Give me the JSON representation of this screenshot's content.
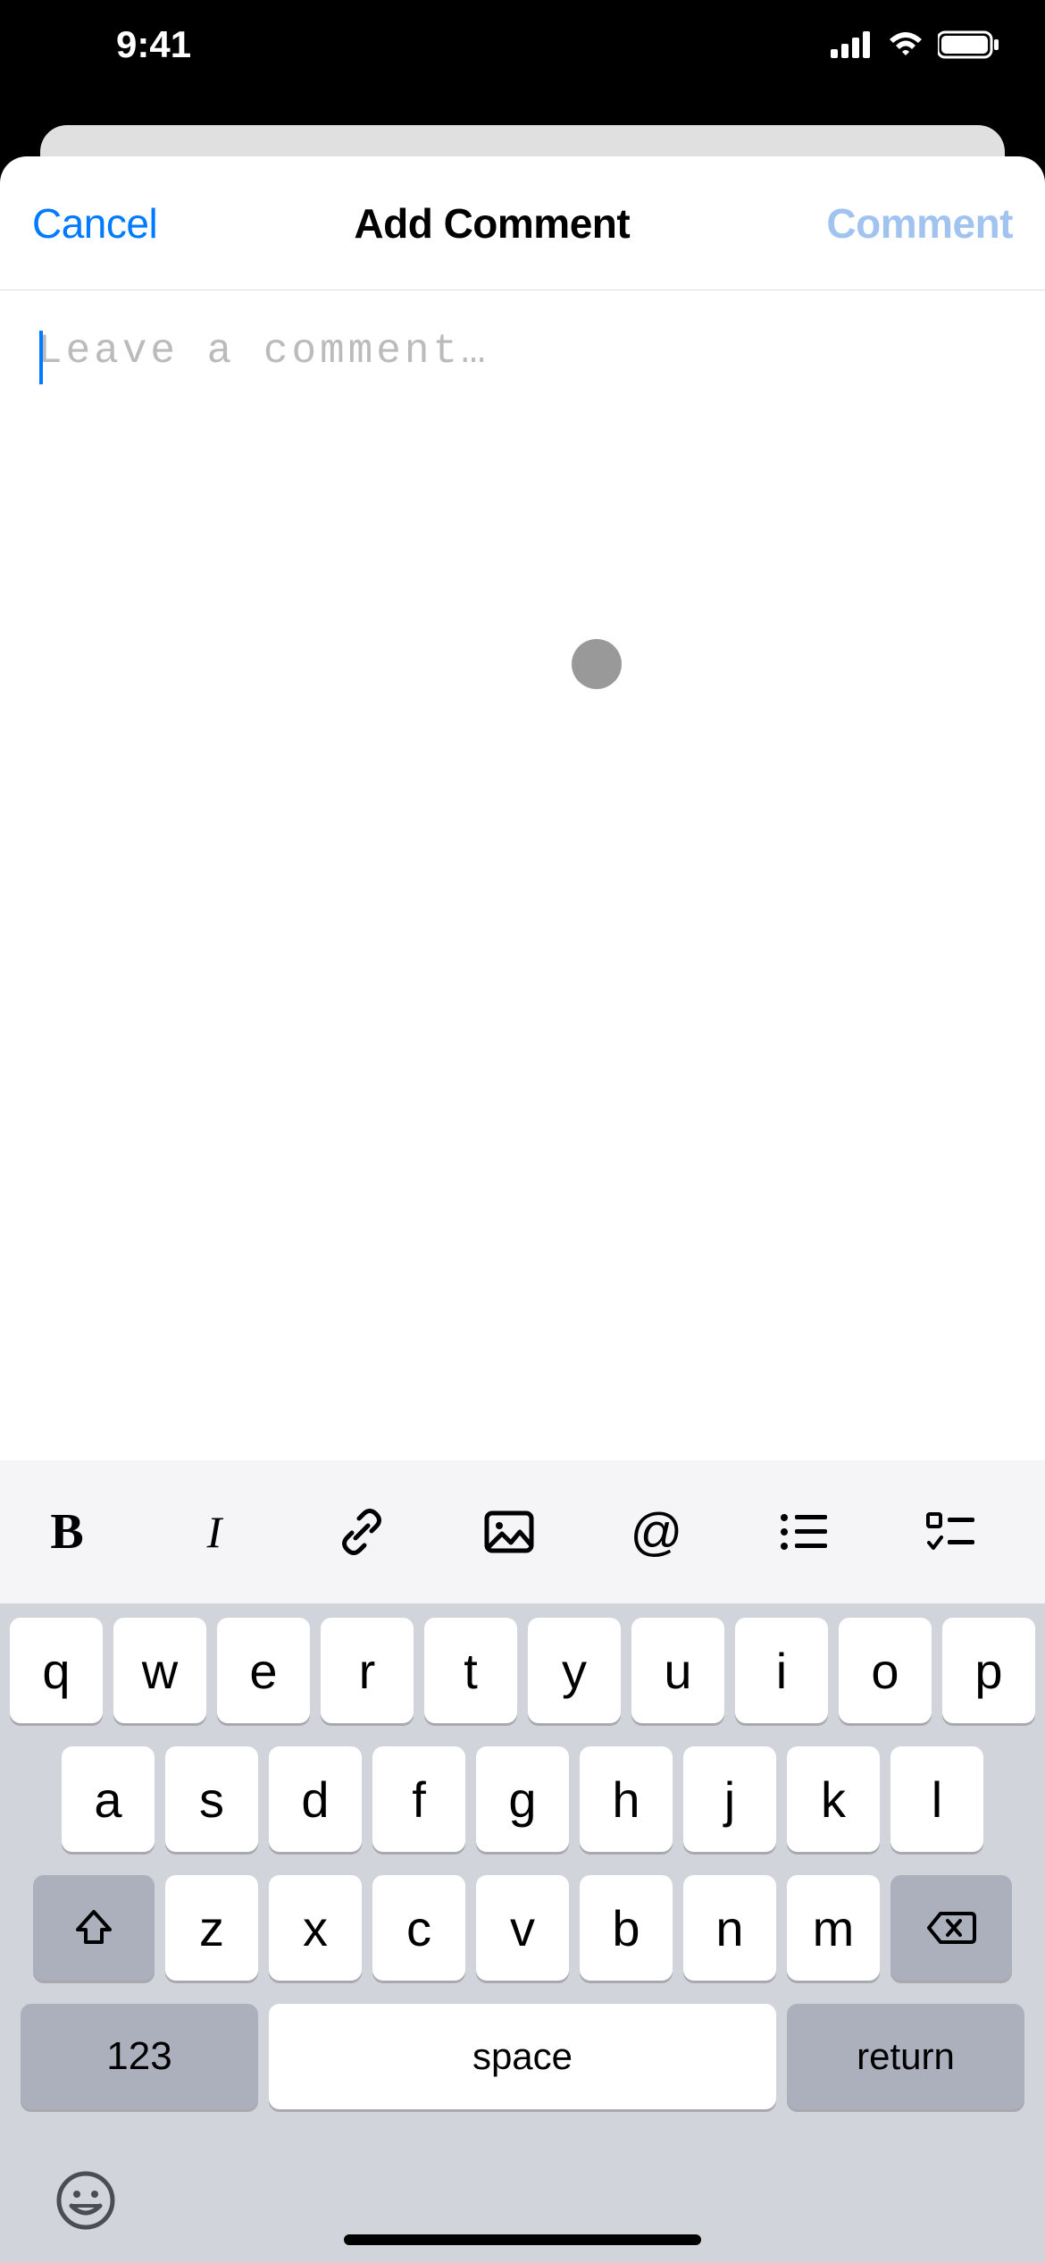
{
  "status": {
    "time": "9:41"
  },
  "modal": {
    "cancel": "Cancel",
    "title": "Add Comment",
    "submit": "Comment"
  },
  "editor": {
    "placeholder": "Leave a comment…"
  },
  "toolbar": {
    "bold": "B",
    "italic": "I",
    "at": "@"
  },
  "keyboard": {
    "row1": [
      "q",
      "w",
      "e",
      "r",
      "t",
      "y",
      "u",
      "i",
      "o",
      "p"
    ],
    "row2": [
      "a",
      "s",
      "d",
      "f",
      "g",
      "h",
      "j",
      "k",
      "l"
    ],
    "row3": [
      "z",
      "x",
      "c",
      "v",
      "b",
      "n",
      "m"
    ],
    "numbers": "123",
    "space": "space",
    "return": "return"
  }
}
